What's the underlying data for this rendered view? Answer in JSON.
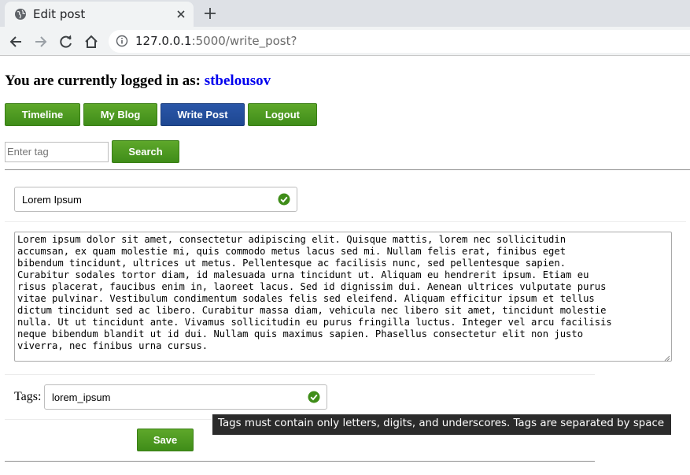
{
  "browser": {
    "tab_title": "Edit post",
    "url_host": "127.0.0.1",
    "url_path": ":5000/write_post?"
  },
  "header": {
    "logged_in_prefix": "You are currently logged in as: ",
    "username": "stbelousov"
  },
  "nav": {
    "timeline": "Timeline",
    "my_blog": "My Blog",
    "write_post": "Write Post",
    "logout": "Logout"
  },
  "search": {
    "placeholder": "Enter tag",
    "button": "Search"
  },
  "form": {
    "title_value": "Lorem Ipsum",
    "body_value": "Lorem ipsum dolor sit amet, consectetur adipiscing elit. Quisque mattis, lorem nec sollicitudin\naccumsan, ex quam molestie mi, quis commodo metus lacus sed mi. Nullam felis erat, finibus eget\nbibendum tincidunt, ultrices ut metus. Pellentesque ac facilisis nunc, sed pellentesque sapien.\nCurabitur sodales tortor diam, id malesuada urna tincidunt ut. Aliquam eu hendrerit ipsum. Etiam eu\nrisus placerat, faucibus enim in, laoreet lacus. Sed id dignissim dui. Aenean ultrices vulputate purus\nvitae pulvinar. Vestibulum condimentum sodales felis sed eleifend. Aliquam efficitur ipsum et tellus\ndictum tincidunt sed ac libero. Curabitur massa diam, vehicula nec libero sit amet, tincidunt molestie\nnulla. Ut ut tincidunt ante. Vivamus sollicitudin eu purus fringilla luctus. Integer vel arcu facilisis\nneque bibendum blandit ut id dui. Nullam quis maximus sapien. Phasellus consectetur elit non justo\nviverra, nec finibus urna cursus.",
    "tags_label": "Tags:",
    "tags_value": "lorem_ipsum",
    "tags_tooltip": "Tags must contain only letters, digits, and underscores. Tags are separated by space",
    "save": "Save"
  },
  "colors": {
    "green_button": "#4b9a21",
    "active_button": "#2450a0",
    "valid_check": "#3f8d19",
    "username_link": "#0000ee"
  },
  "icons": [
    "globe-icon",
    "close-icon",
    "plus-icon",
    "back-icon",
    "forward-icon",
    "reload-icon",
    "home-icon",
    "info-icon",
    "checkmark-icon"
  ]
}
